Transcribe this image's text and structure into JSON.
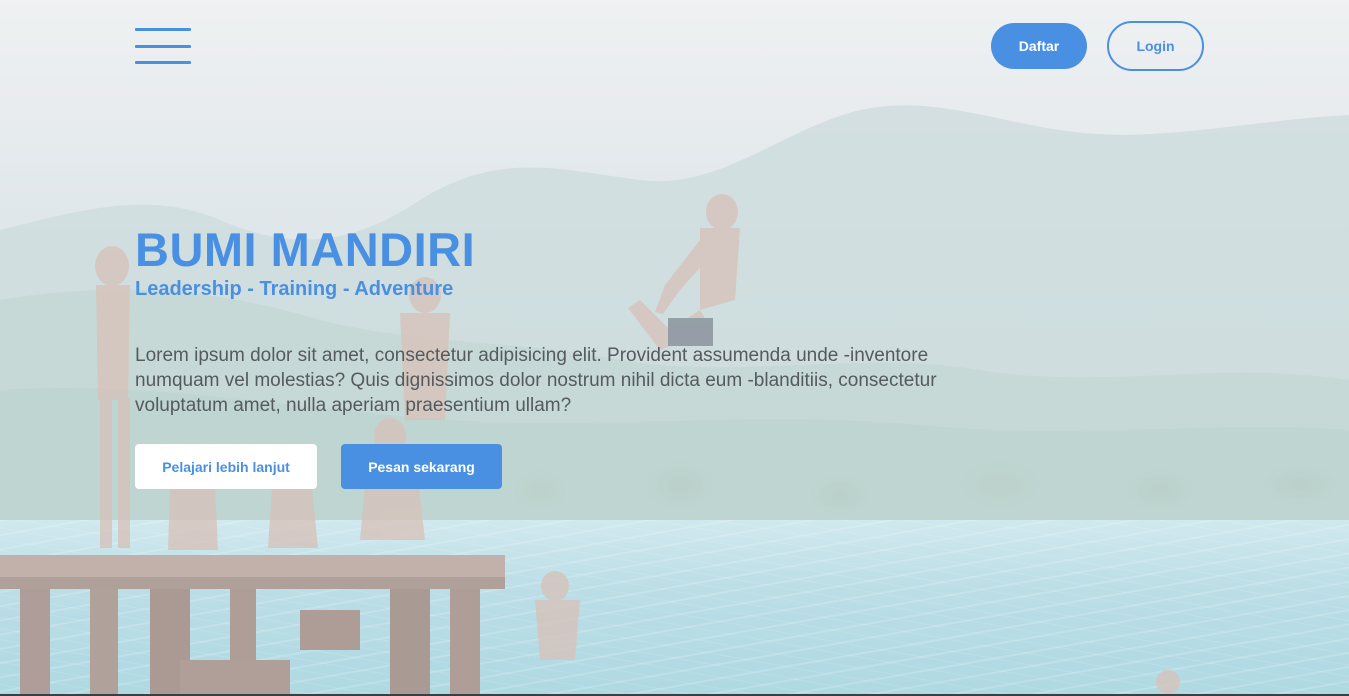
{
  "header": {
    "menu_icon": "hamburger-menu-icon",
    "register_label": "Daftar",
    "login_label": "Login"
  },
  "hero": {
    "title": "BUMI MANDIRI",
    "subtitle": "Leadership - Training - Adventure",
    "description": "Lorem ipsum dolor sit amet, consectetur adipisicing elit. Provident assumenda unde -inventore numquam vel molestias? Quis dignissimos dolor nostrum nihil dicta eum -blanditiis, consectetur voluptatum amet, nulla aperiam praesentium ullam?",
    "learn_more_label": "Pelajari lebih lanjut",
    "order_label": "Pesan sekarang"
  },
  "colors": {
    "accent": "#4a90e2",
    "text": "#555a5e",
    "white": "#ffffff"
  }
}
